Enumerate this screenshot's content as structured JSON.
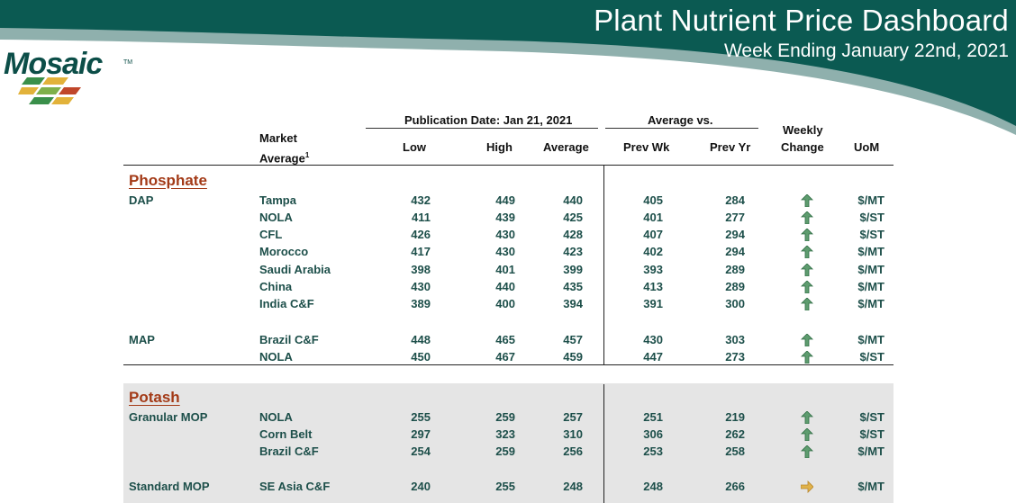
{
  "header": {
    "title": "Plant Nutrient Price Dashboard",
    "subtitle": "Week Ending January 22nd, 2021",
    "logo_text": "Mosaic",
    "logo_tm": "TM"
  },
  "colors": {
    "banner_dark": "#0b5a52",
    "banner_light": "#8fb0ad",
    "text_green": "#1d4f4a",
    "section_red": "#a33a17",
    "arrow_up": "#5e9c6f",
    "arrow_right": "#e0b24a"
  },
  "table": {
    "pub_date_label": "Publication Date:  Jan 21, 2021",
    "avg_vs_label": "Average  vs.",
    "columns": {
      "market": "Market",
      "average": "Average",
      "average_sup": "1",
      "low": "Low",
      "high": "High",
      "avg": "Average",
      "prev_wk": "Prev Wk",
      "prev_yr": "Prev Yr",
      "weekly": "Weekly",
      "change": "Change",
      "uom": "UoM"
    },
    "sections": [
      {
        "name": "Phosphate",
        "groups": [
          {
            "product": "DAP",
            "rows": [
              {
                "market": "Tampa",
                "low": "432",
                "high": "449",
                "avg": "440",
                "prev_wk": "405",
                "prev_yr": "284",
                "change": "up-arrow-icon",
                "uom": "$/MT"
              },
              {
                "market": "NOLA",
                "low": "411",
                "high": "439",
                "avg": "425",
                "prev_wk": "401",
                "prev_yr": "277",
                "change": "up-arrow-icon",
                "uom": "$/ST"
              },
              {
                "market": "CFL",
                "low": "426",
                "high": "430",
                "avg": "428",
                "prev_wk": "407",
                "prev_yr": "294",
                "change": "up-arrow-icon",
                "uom": "$/ST"
              },
              {
                "market": "Morocco",
                "low": "417",
                "high": "430",
                "avg": "423",
                "prev_wk": "402",
                "prev_yr": "294",
                "change": "up-arrow-icon",
                "uom": "$/MT"
              },
              {
                "market": "Saudi Arabia",
                "low": "398",
                "high": "401",
                "avg": "399",
                "prev_wk": "393",
                "prev_yr": "289",
                "change": "up-arrow-icon",
                "uom": "$/MT"
              },
              {
                "market": "China",
                "low": "430",
                "high": "440",
                "avg": "435",
                "prev_wk": "413",
                "prev_yr": "289",
                "change": "up-arrow-icon",
                "uom": "$/MT"
              },
              {
                "market": "India C&F",
                "low": "389",
                "high": "400",
                "avg": "394",
                "prev_wk": "391",
                "prev_yr": "300",
                "change": "up-arrow-icon",
                "uom": "$/MT"
              }
            ]
          },
          {
            "product": "MAP",
            "rows": [
              {
                "market": "Brazil C&F",
                "low": "448",
                "high": "465",
                "avg": "457",
                "prev_wk": "430",
                "prev_yr": "303",
                "change": "up-arrow-icon",
                "uom": "$/MT"
              },
              {
                "market": "NOLA",
                "low": "450",
                "high": "467",
                "avg": "459",
                "prev_wk": "447",
                "prev_yr": "273",
                "change": "up-arrow-icon",
                "uom": "$/ST"
              }
            ]
          }
        ]
      },
      {
        "name": "Potash",
        "groups": [
          {
            "product": "Granular MOP",
            "rows": [
              {
                "market": "NOLA",
                "low": "255",
                "high": "259",
                "avg": "257",
                "prev_wk": "251",
                "prev_yr": "219",
                "change": "up-arrow-icon",
                "uom": "$/ST"
              },
              {
                "market": "Corn Belt",
                "low": "297",
                "high": "323",
                "avg": "310",
                "prev_wk": "306",
                "prev_yr": "262",
                "change": "up-arrow-icon",
                "uom": "$/ST"
              },
              {
                "market": "Brazil C&F",
                "low": "254",
                "high": "259",
                "avg": "256",
                "prev_wk": "253",
                "prev_yr": "258",
                "change": "up-arrow-icon",
                "uom": "$/MT"
              }
            ]
          },
          {
            "product": "Standard MOP",
            "rows": [
              {
                "market": "SE Asia C&F",
                "low": "240",
                "high": "255",
                "avg": "248",
                "prev_wk": "248",
                "prev_yr": "266",
                "change": "right-arrow-icon",
                "uom": "$/MT"
              }
            ]
          }
        ]
      }
    ]
  }
}
